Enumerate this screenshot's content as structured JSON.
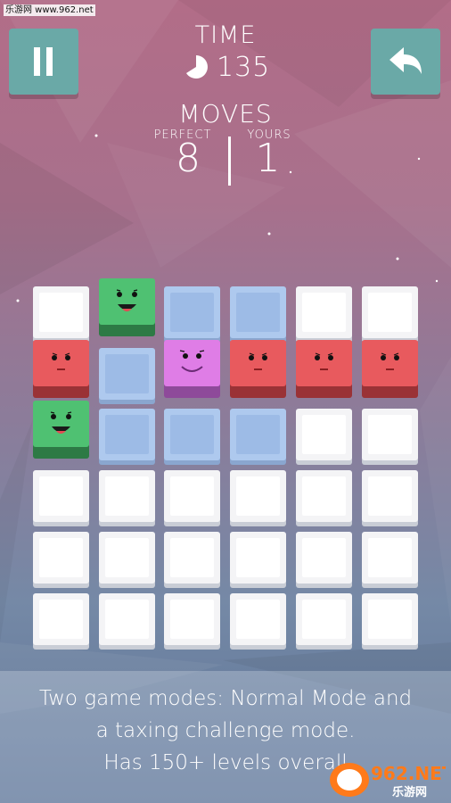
{
  "watermark": "乐游网 www.962.net",
  "hud": {
    "time_label": "TIME",
    "time_value": "135",
    "moves_label": "MOVES",
    "perfect_label": "PERFECT",
    "perfect_value": "8",
    "yours_label": "YOURS",
    "yours_value": "1"
  },
  "buttons": {
    "pause": "pause-icon",
    "undo": "undo-arrow-icon"
  },
  "grid": {
    "rows": 6,
    "cols": 6,
    "tiles": [
      [
        "white",
        "green",
        "blue",
        "blue",
        "white",
        "white"
      ],
      [
        "red",
        "blue",
        "pink",
        "red",
        "red",
        "red"
      ],
      [
        "green",
        "blue",
        "blue",
        "blue",
        "white",
        "white"
      ],
      [
        "white",
        "white",
        "white",
        "white",
        "white",
        "white"
      ],
      [
        "white",
        "white",
        "white",
        "white",
        "white",
        "white"
      ],
      [
        "white",
        "white",
        "white",
        "white",
        "white",
        "white"
      ]
    ]
  },
  "caption": {
    "line1": "Two game modes: Normal Mode and",
    "line2": "a taxing challenge mode.",
    "line3": "Has 150+ levels overall"
  },
  "logo": {
    "brand": "962.NET",
    "sub": "乐游网"
  },
  "colors": {
    "button": "#6aa9a7",
    "red_block": "#e85a5e",
    "green_block": "#4fc172",
    "pink_block": "#df7de6",
    "blue_tile": "#aec9ee"
  }
}
